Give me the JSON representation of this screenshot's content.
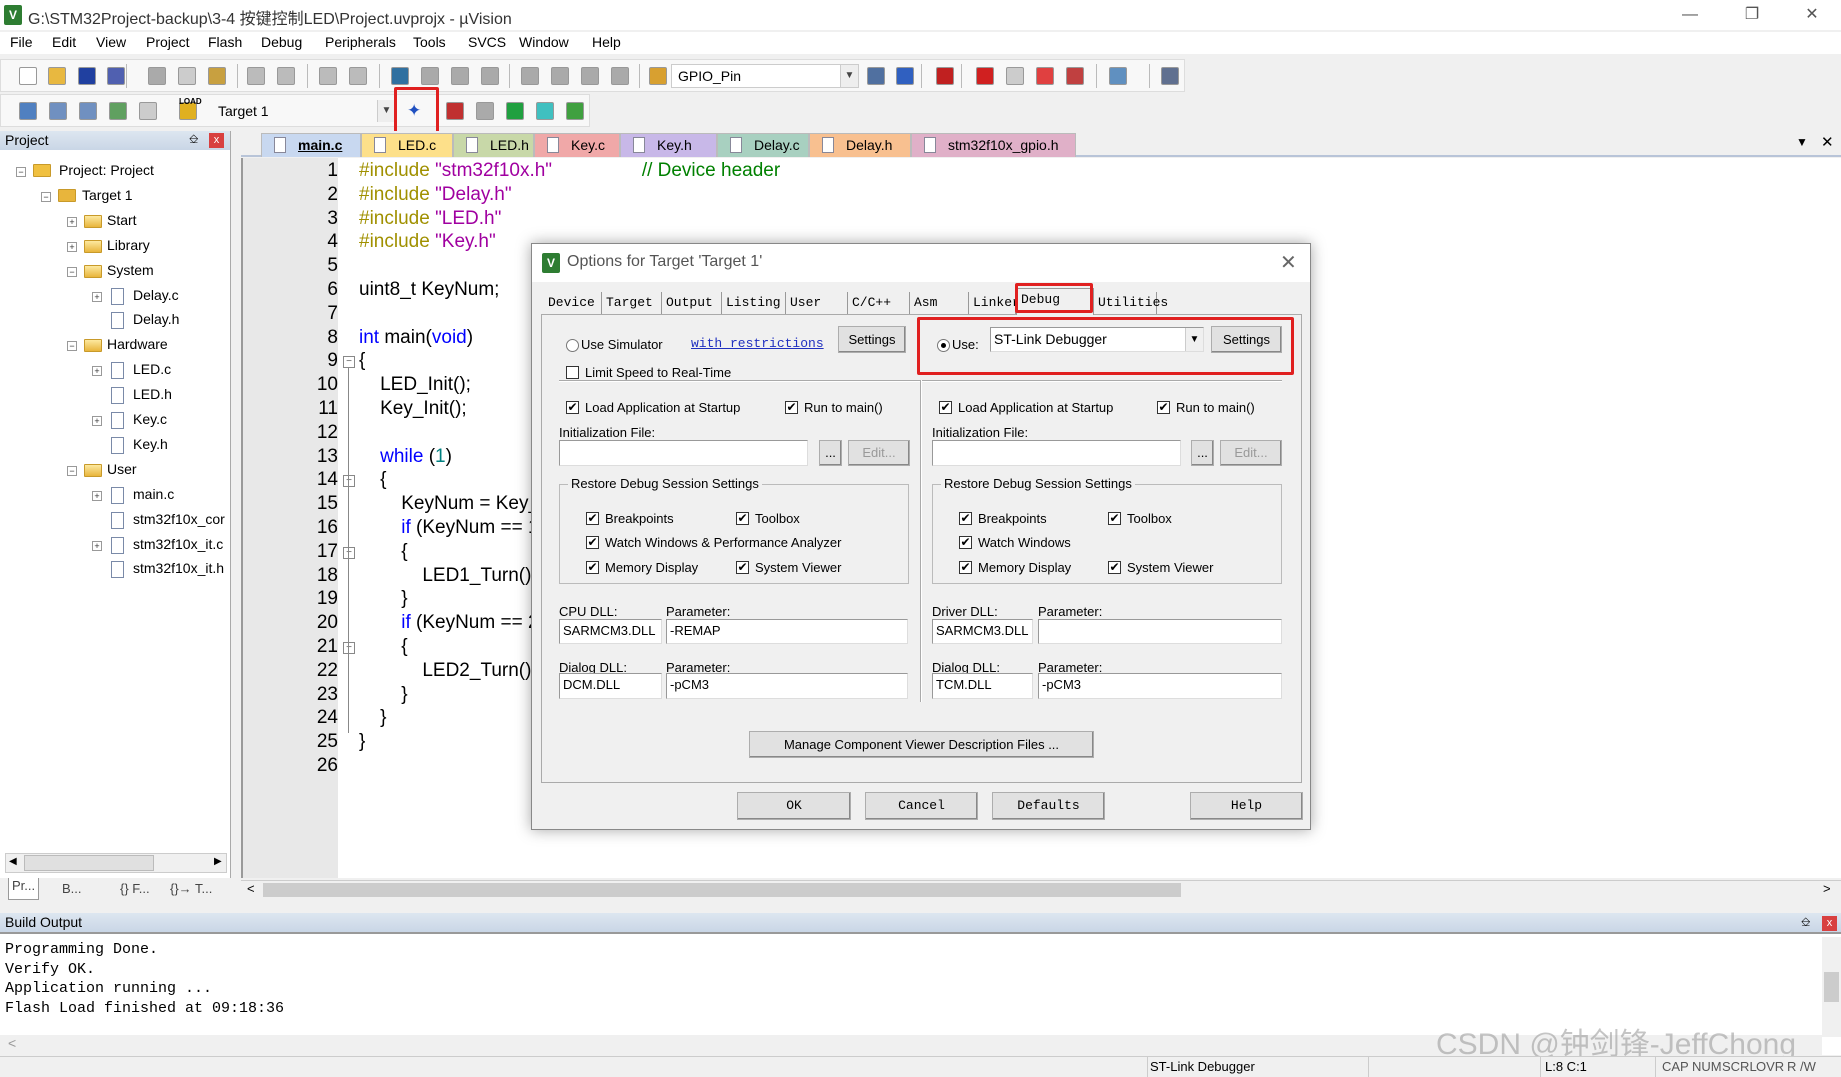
{
  "window": {
    "title": "G:\\STM32Project-backup\\3-4 按键控制LED\\Project.uvprojx - µVision",
    "app_icon": "uvision-icon"
  },
  "menu": [
    "File",
    "Edit",
    "View",
    "Project",
    "Flash",
    "Debug",
    "Peripherals",
    "Tools",
    "SVCS",
    "Window",
    "Help"
  ],
  "toolbar": {
    "find_combo": "GPIO_Pin",
    "target_combo": "Target 1",
    "load_label": "LOAD"
  },
  "project_panel": {
    "title": "Project",
    "tree": [
      {
        "label": "Project: Project",
        "level": 0,
        "expander": "-",
        "icon": "project"
      },
      {
        "label": "Target 1",
        "level": 1,
        "expander": "-",
        "icon": "target"
      },
      {
        "label": "Start",
        "level": 2,
        "expander": "+",
        "icon": "folder"
      },
      {
        "label": "Library",
        "level": 2,
        "expander": "+",
        "icon": "folder"
      },
      {
        "label": "System",
        "level": 2,
        "expander": "-",
        "icon": "folder-open"
      },
      {
        "label": "Delay.c",
        "level": 3,
        "expander": "+",
        "icon": "file"
      },
      {
        "label": "Delay.h",
        "level": 3,
        "expander": "",
        "icon": "file"
      },
      {
        "label": "Hardware",
        "level": 2,
        "expander": "-",
        "icon": "folder-open"
      },
      {
        "label": "LED.c",
        "level": 3,
        "expander": "+",
        "icon": "file"
      },
      {
        "label": "LED.h",
        "level": 3,
        "expander": "",
        "icon": "file"
      },
      {
        "label": "Key.c",
        "level": 3,
        "expander": "+",
        "icon": "file"
      },
      {
        "label": "Key.h",
        "level": 3,
        "expander": "",
        "icon": "file"
      },
      {
        "label": "User",
        "level": 2,
        "expander": "-",
        "icon": "folder-open"
      },
      {
        "label": "main.c",
        "level": 3,
        "expander": "+",
        "icon": "file"
      },
      {
        "label": "stm32f10x_cor",
        "level": 3,
        "expander": "",
        "icon": "file"
      },
      {
        "label": "stm32f10x_it.c",
        "level": 3,
        "expander": "+",
        "icon": "file"
      },
      {
        "label": "stm32f10x_it.h",
        "level": 3,
        "expander": "",
        "icon": "file"
      }
    ],
    "bottom_tabs": [
      "Pr...",
      "B...",
      "{} F...",
      "{}→ T..."
    ]
  },
  "file_tabs": [
    {
      "label": "main.c",
      "color": "#c8d8f0",
      "active": true
    },
    {
      "label": "LED.c",
      "color": "#fde08a"
    },
    {
      "label": "LED.h",
      "color": "#c8d8a8"
    },
    {
      "label": "Key.c",
      "color": "#f0a8a8"
    },
    {
      "label": "Key.h",
      "color": "#c8b8e8"
    },
    {
      "label": "Delay.c",
      "color": "#a8d0c0"
    },
    {
      "label": "Delay.h",
      "color": "#f8c090"
    },
    {
      "label": "stm32f10x_gpio.h",
      "color": "#e0b0c8"
    }
  ],
  "code_lines": [
    [
      [
        "pp",
        "#include "
      ],
      [
        "str",
        "\"stm32f10x.h\""
      ],
      [
        "tx",
        "                 "
      ],
      [
        "cm",
        "// Device header"
      ]
    ],
    [
      [
        "pp",
        "#include "
      ],
      [
        "str",
        "\"Delay.h\""
      ]
    ],
    [
      [
        "pp",
        "#include "
      ],
      [
        "str",
        "\"LED.h\""
      ]
    ],
    [
      [
        "pp",
        "#include "
      ],
      [
        "str",
        "\"Key.h\""
      ]
    ],
    [],
    [
      [
        "tx",
        "uint8_t KeyNum;"
      ]
    ],
    [],
    [
      [
        "kw",
        "int"
      ],
      [
        "tx",
        " main("
      ],
      [
        "kw",
        "void"
      ],
      [
        "tx",
        ")"
      ]
    ],
    [
      [
        "tx",
        "{"
      ]
    ],
    [
      [
        "tx",
        "    LED_Init();"
      ]
    ],
    [
      [
        "tx",
        "    Key_Init();"
      ]
    ],
    [],
    [
      [
        "kw",
        "    while"
      ],
      [
        "tx",
        " ("
      ],
      [
        "num",
        "1"
      ],
      [
        "tx",
        ")"
      ]
    ],
    [
      [
        "tx",
        "    {"
      ]
    ],
    [
      [
        "tx",
        "        KeyNum = Key_"
      ]
    ],
    [
      [
        "kw",
        "        if"
      ],
      [
        "tx",
        " (KeyNum == 1"
      ]
    ],
    [
      [
        "tx",
        "        {"
      ]
    ],
    [
      [
        "tx",
        "            LED1_Turn()"
      ]
    ],
    [
      [
        "tx",
        "        }"
      ]
    ],
    [
      [
        "kw",
        "        if"
      ],
      [
        "tx",
        " (KeyNum == 2"
      ]
    ],
    [
      [
        "tx",
        "        {"
      ]
    ],
    [
      [
        "tx",
        "            LED2_Turn()"
      ]
    ],
    [
      [
        "tx",
        "        }"
      ]
    ],
    [
      [
        "tx",
        "    }"
      ]
    ],
    [
      [
        "tx",
        "}"
      ]
    ],
    []
  ],
  "fold_lines": [
    9,
    14,
    17,
    21
  ],
  "build_output": {
    "title": "Build Output",
    "lines": [
      "Programming Done.",
      "Verify OK.",
      "Application running ...",
      "Flash Load finished at 09:18:36"
    ]
  },
  "status_bar": {
    "debugger": "ST-Link Debugger",
    "position": "L:8 C:1",
    "indicators": [
      "CAP",
      "NUM",
      "SCRL",
      "OVR",
      "R /W"
    ]
  },
  "watermark": "CSDN @钟剑锋-JeffChong",
  "dialog": {
    "title": "Options for Target 'Target 1'",
    "tabs": [
      "Device",
      "Target",
      "Output",
      "Listing",
      "User",
      "C/C++",
      "Asm",
      "Linker",
      "Debug",
      "Utilities"
    ],
    "active_tab": "Debug",
    "left": {
      "use_simulator": "Use Simulator",
      "with_restrictions": "with restrictions",
      "settings": "Settings",
      "limit_speed": "Limit Speed to Real-Time",
      "load_app": "Load Application at Startup",
      "run_to_main": "Run to main()",
      "init_file_label": "Initialization File:",
      "init_file": "",
      "browse": "...",
      "edit": "Edit...",
      "restore_group": "Restore Debug Session Settings",
      "breakpoints": "Breakpoints",
      "toolbox": "Toolbox",
      "watch": "Watch Windows & Performance Analyzer",
      "memory": "Memory Display",
      "sysviewer": "System Viewer",
      "dll_label": "CPU DLL:",
      "param_label": "Parameter:",
      "dll": "SARMCM3.DLL",
      "param": "-REMAP",
      "dialog_dll_label": "Dialog DLL:",
      "dialog_param_label": "Parameter:",
      "dialog_dll": "DCM.DLL",
      "dialog_param": "-pCM3"
    },
    "right": {
      "use_label": "Use:",
      "debugger": "ST-Link Debugger",
      "settings": "Settings",
      "load_app": "Load Application at Startup",
      "run_to_main": "Run to main()",
      "init_file_label": "Initialization File:",
      "init_file": "",
      "browse": "...",
      "edit": "Edit...",
      "restore_group": "Restore Debug Session Settings",
      "breakpoints": "Breakpoints",
      "toolbox": "Toolbox",
      "watch": "Watch Windows",
      "memory": "Memory Display",
      "sysviewer": "System Viewer",
      "dll_label": "Driver DLL:",
      "param_label": "Parameter:",
      "dll": "SARMCM3.DLL",
      "param": "",
      "dialog_dll_label": "Dialog DLL:",
      "dialog_param_label": "Parameter:",
      "dialog_dll": "TCM.DLL",
      "dialog_param": "-pCM3"
    },
    "manage_btn": "Manage Component Viewer Description Files ...",
    "ok": "OK",
    "cancel": "Cancel",
    "defaults": "Defaults",
    "help": "Help"
  },
  "highlight_color": "#e02020"
}
